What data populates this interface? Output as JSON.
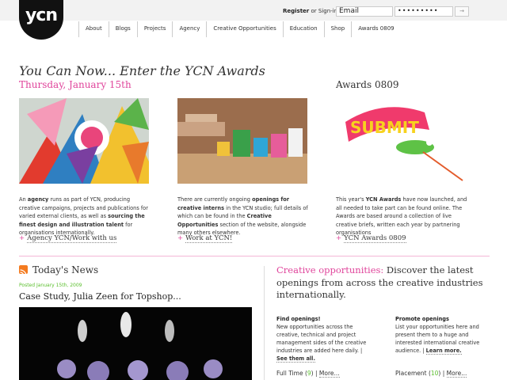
{
  "logo": {
    "text": "ycn"
  },
  "auth": {
    "register": "Register",
    "or_signin": "or Sign-in:",
    "email_value": "Email",
    "password_value": "•••••••••",
    "go": "→"
  },
  "nav": [
    "About",
    "Blogs",
    "Projects",
    "Agency",
    "Creative Opportunities",
    "Education",
    "Shop",
    "Awards 0809"
  ],
  "header": {
    "headline": "You Can Now... Enter the YCN Awards",
    "date": "Thursday, January 15th",
    "awards_heading": "Awards 0809"
  },
  "columns": {
    "agency": {
      "p1": "An ",
      "b1": "agency",
      "p2": " runs as part of YCN, producing creative campaigns, projects and publications for varied external clients, as well as ",
      "b2": "sourcing the finest design and illustration talent",
      "p3": " for organisations internationally.",
      "link": "Agency YCN/Work with us"
    },
    "work": {
      "p1": "There are currently ongoing ",
      "b1": "openings for creative interns",
      "p2": " in the YCN studio; full details of which can be found in the ",
      "b2": "Creative Opportunities",
      "p3": " section of the website, alongside many others elsewhere.",
      "link": "Work at YCN!"
    },
    "awards": {
      "p1": "This year's ",
      "b1": "YCN Awards",
      "p2": " have now launched, and all needed to take part can be found online. The Awards are based around a collection of live creative briefs, written each year by partnering organisations",
      "link": "YCN Awards 0809"
    }
  },
  "news": {
    "title": "Today's News",
    "posted": "Posted January 15th, 2009",
    "headline": "Case Study, Julia Zeen for Topshop..."
  },
  "creative": {
    "highlight": "Creative opportunities:",
    "text": " Discover the latest openings from across the creative industries internationally.",
    "find_head": "Find openings!",
    "find_text": "New opportunities across the creative, technical and project management sides of the creative industries are added here daily. | ",
    "find_link": "See them all.",
    "promote_head": "Promote openings",
    "promote_text": "List your opportunities here and present them to a huge and interested international creative audience. | ",
    "promote_link": "Learn more.",
    "stat1_label": "Full Time (",
    "stat1_num": "9",
    "stat1_end": ") | ",
    "stat1_link": "More...",
    "stat2_label": "Placement (",
    "stat2_num": "10",
    "stat2_end": ") | ",
    "stat2_link": "More..."
  },
  "colors": {
    "accent": "#e0449b",
    "green": "#5bbf2e",
    "rss": "#f47b20"
  }
}
